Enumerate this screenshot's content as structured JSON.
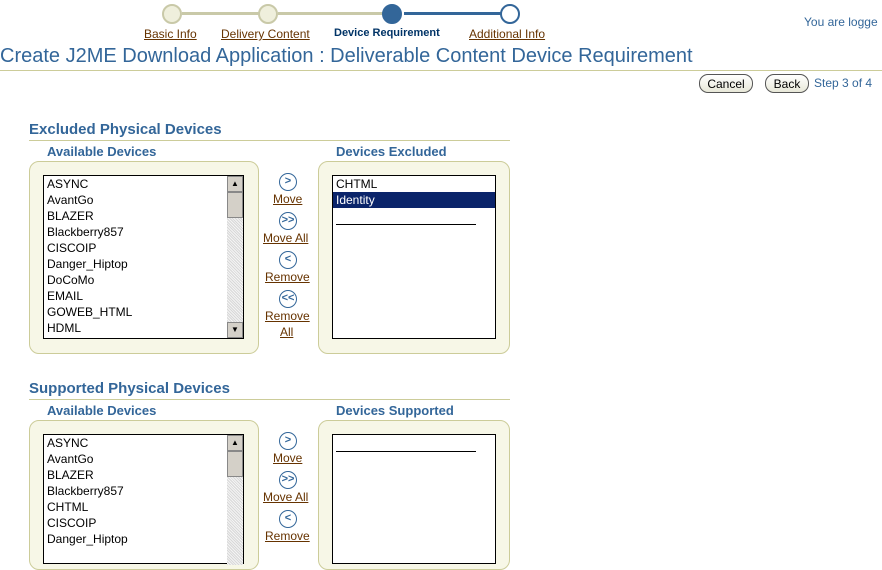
{
  "train": {
    "steps": [
      {
        "label": "Basic Info",
        "state": "done"
      },
      {
        "label": "Delivery Content",
        "state": "done"
      },
      {
        "label": "Device Requirement",
        "state": "current"
      },
      {
        "label": "Additional Info",
        "state": "future"
      }
    ]
  },
  "header": {
    "logged_text": "You are logge",
    "title": "Create J2ME Download Application : Deliverable Content Device Requirement"
  },
  "actions": {
    "cancel": "Cancel",
    "back": "Back",
    "step": "Step 3 of 4"
  },
  "excluded": {
    "heading": "Excluded Physical Devices",
    "available_header": "Available Devices",
    "selected_header": "Devices Excluded",
    "available": [
      "ASYNC",
      "AvantGo",
      "BLAZER",
      "Blackberry857",
      "CISCOIP",
      "Danger_Hiptop",
      "DoCoMo",
      "EMAIL",
      "GOWEB_HTML",
      "HDML"
    ],
    "selected": [
      "CHTML",
      "Identity"
    ],
    "selected_highlight": "Identity"
  },
  "supported": {
    "heading": "Supported Physical Devices",
    "available_header": "Available Devices",
    "selected_header": "Devices Supported",
    "available": [
      "ASYNC",
      "AvantGo",
      "BLAZER",
      "Blackberry857",
      "CHTML",
      "CISCOIP",
      "Danger_Hiptop"
    ],
    "selected": []
  },
  "shuttle": {
    "move": "Move",
    "move_all": "Move All",
    "remove": "Remove",
    "remove_all_1": "Remove",
    "remove_all_2": "All"
  },
  "colors": {
    "accent": "#336699",
    "link": "#663300",
    "panel": "#f7f7e7",
    "selection": "#0a246a"
  }
}
